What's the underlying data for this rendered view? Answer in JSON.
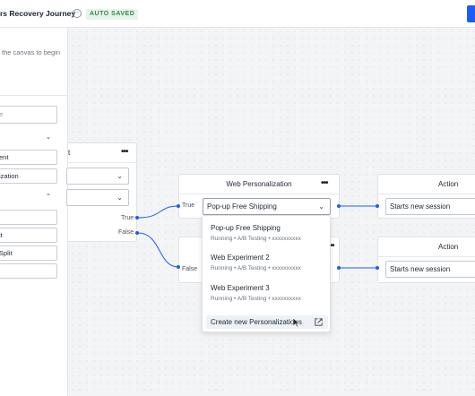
{
  "header": {
    "title": "rs Recovery Journey",
    "status_badge": "AUTO SAVED"
  },
  "left_panel": {
    "hint_line1": "the canvas to begin",
    "hint_line2": "",
    "search_placeholder": "e",
    "section1_items": [
      "ent",
      "ization"
    ],
    "section2_items": [
      "",
      "it",
      "Split",
      ""
    ]
  },
  "canvas": {
    "partial_node": {
      "title": "t",
      "ports": {
        "true": "True",
        "false": "False"
      }
    },
    "web_personalization": {
      "title": "Web Personalization",
      "branch_true": "True",
      "branch_false": "False",
      "selected": "Pop-up Free Shipping"
    },
    "action_nodes": [
      {
        "title": "Action",
        "value": "Starts new session"
      },
      {
        "title": "Action",
        "value": "Starts new session"
      }
    ],
    "dropdown_menu": {
      "items": [
        {
          "title": "Pop-up Free Shipping",
          "subtitle": "Running • A/B Testing • xxxxxxxxxx"
        },
        {
          "title": "Web Experiment 2",
          "subtitle": "Running • A/B Testing • xxxxxxxxxx"
        },
        {
          "title": "Web Experiment 3",
          "subtitle": "Running • A/B Testing • xxxxxxxxxx"
        }
      ],
      "create_label": "Create new Personalizations"
    }
  },
  "icons": {
    "edit": "edit-circle-icon",
    "more": "more-dots-icon",
    "chevron": "chevron-down-icon",
    "external": "external-link-icon",
    "cursor": "mouse-pointer-icon"
  },
  "colors": {
    "accent": "#1d5cf5",
    "saved_bg": "#e7f4ea",
    "saved_text": "#2f8a4a"
  }
}
